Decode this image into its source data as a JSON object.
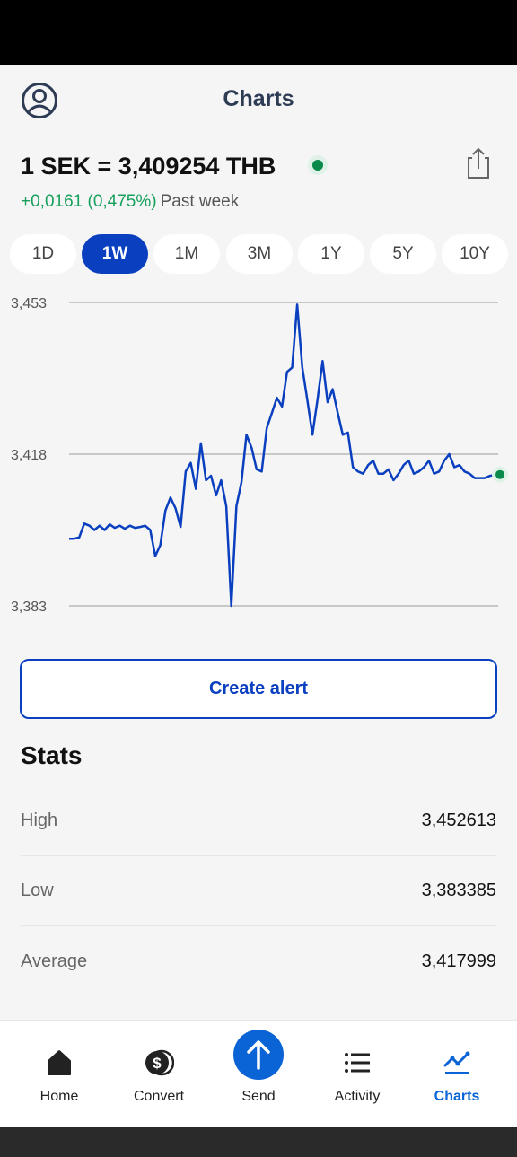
{
  "header": {
    "title": "Charts"
  },
  "rate": {
    "text": "1 SEK = 3,409254 THB",
    "change": "+0,0161 (0,475%)",
    "period": "Past week"
  },
  "ranges": [
    {
      "label": "1D"
    },
    {
      "label": "1W",
      "active": true
    },
    {
      "label": "1M"
    },
    {
      "label": "3M"
    },
    {
      "label": "1Y"
    },
    {
      "label": "5Y"
    },
    {
      "label": "10Y"
    }
  ],
  "chart_data": {
    "type": "line",
    "ylim": [
      3.383,
      3.453
    ],
    "ytick_labels": [
      "3,453",
      "3,418",
      "3,383"
    ],
    "grid": true,
    "series": [
      {
        "color": "#0a3fbf",
        "values": [
          3.3985,
          3.3985,
          3.3988,
          3.402,
          3.4015,
          3.4005,
          3.4015,
          3.4005,
          3.4018,
          3.401,
          3.4015,
          3.4008,
          3.4015,
          3.401,
          3.4012,
          3.4015,
          3.4005,
          3.3945,
          3.397,
          3.405,
          3.408,
          3.4055,
          3.4012,
          3.414,
          3.416,
          3.41,
          3.4205,
          3.412,
          3.413,
          3.4085,
          3.412,
          3.406,
          3.383,
          3.406,
          3.4115,
          3.4225,
          3.4195,
          3.4145,
          3.414,
          3.424,
          3.4275,
          3.431,
          3.429,
          3.437,
          3.438,
          3.4525,
          3.438,
          3.4305,
          3.4225,
          3.4305,
          3.4395,
          3.43,
          3.433,
          3.4275,
          3.4225,
          3.423,
          3.415,
          3.414,
          3.4135,
          3.4155,
          3.4165,
          3.4135,
          3.4135,
          3.4145,
          3.412,
          3.4135,
          3.4155,
          3.4165,
          3.4135,
          3.414,
          3.415,
          3.4165,
          3.4135,
          3.414,
          3.4165,
          3.418,
          3.415,
          3.4155,
          3.414,
          3.4135,
          3.4125,
          3.4125,
          3.4125,
          3.413,
          3.4132,
          3.4133
        ]
      }
    ]
  },
  "alert_button": {
    "label": "Create alert"
  },
  "stats": {
    "title": "Stats",
    "rows": [
      {
        "label": "High",
        "value": "3,452613"
      },
      {
        "label": "Low",
        "value": "3,383385"
      },
      {
        "label": "Average",
        "value": "3,417999"
      }
    ]
  },
  "nav": [
    {
      "label": "Home",
      "icon": "home-icon"
    },
    {
      "label": "Convert",
      "icon": "convert-icon"
    },
    {
      "label": "Send",
      "icon": "send-icon"
    },
    {
      "label": "Activity",
      "icon": "activity-icon"
    },
    {
      "label": "Charts",
      "icon": "charts-icon",
      "active": true
    }
  ],
  "colors": {
    "accent": "#0a3fbf",
    "nav_active": "#0a64d6",
    "positive": "#16a05c",
    "live_dot": "#0a8a4a"
  }
}
